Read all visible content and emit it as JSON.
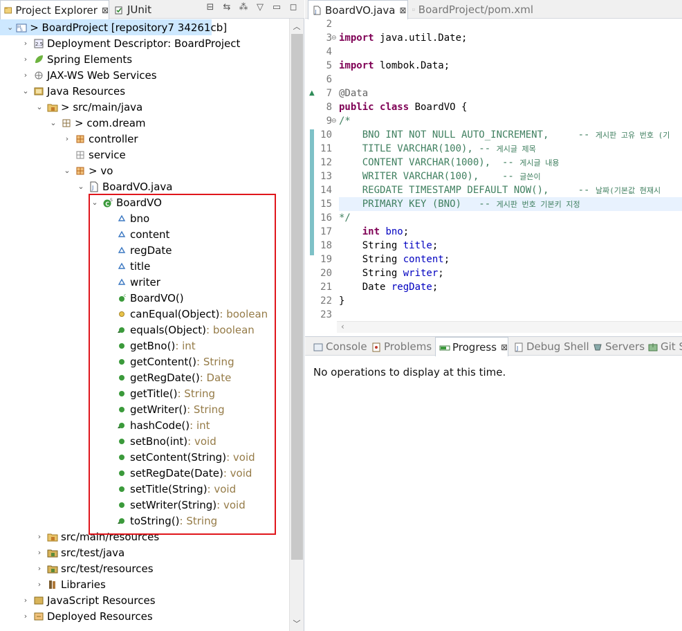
{
  "left_panel": {
    "tabs": [
      {
        "label": "Project Explorer",
        "close": "⊠"
      },
      {
        "label": "JUnit"
      }
    ]
  },
  "tree": [
    {
      "label": "> BoardProject [repository7 34261cb]",
      "indent": 0,
      "twisty": "open",
      "icon": "project"
    },
    {
      "label": "Deployment Descriptor: BoardProject",
      "indent": 1,
      "twisty": "closed",
      "icon": "descriptor"
    },
    {
      "label": "Spring Elements",
      "indent": 1,
      "twisty": "closed",
      "icon": "spring"
    },
    {
      "label": "JAX-WS Web Services",
      "indent": 1,
      "twisty": "closed",
      "icon": "webservice"
    },
    {
      "label": "Java Resources",
      "indent": 1,
      "twisty": "open",
      "icon": "javares"
    },
    {
      "label": "> src/main/java",
      "indent": 2,
      "twisty": "open",
      "icon": "srcfolder"
    },
    {
      "label": "> com.dream",
      "indent": 3,
      "twisty": "open",
      "icon": "package"
    },
    {
      "label": "controller",
      "indent": 4,
      "twisty": "closed",
      "icon": "package-orange"
    },
    {
      "label": "service",
      "indent": 4,
      "twisty": "none",
      "icon": "package-empty"
    },
    {
      "label": "> vo",
      "indent": 4,
      "twisty": "open",
      "icon": "package-orange"
    },
    {
      "label": "BoardVO.java",
      "indent": 5,
      "twisty": "open",
      "icon": "javafile"
    },
    {
      "label": "BoardVO",
      "indent": 6,
      "twisty": "open",
      "icon": "class"
    },
    {
      "label": "bno",
      "indent": 7,
      "twisty": "none",
      "icon": "field"
    },
    {
      "label": "content",
      "indent": 7,
      "twisty": "none",
      "icon": "field"
    },
    {
      "label": "regDate",
      "indent": 7,
      "twisty": "none",
      "icon": "field"
    },
    {
      "label": "title",
      "indent": 7,
      "twisty": "none",
      "icon": "field"
    },
    {
      "label": "writer",
      "indent": 7,
      "twisty": "none",
      "icon": "field"
    },
    {
      "label": "BoardVO()",
      "indent": 7,
      "twisty": "none",
      "icon": "constructor"
    },
    {
      "label": "canEqual(Object)",
      "type": " : boolean",
      "indent": 7,
      "twisty": "none",
      "icon": "method-protected"
    },
    {
      "label": "equals(Object)",
      "type": " : boolean",
      "indent": 7,
      "twisty": "none",
      "icon": "method-override"
    },
    {
      "label": "getBno()",
      "type": " : int",
      "indent": 7,
      "twisty": "none",
      "icon": "method"
    },
    {
      "label": "getContent()",
      "type": " : String",
      "indent": 7,
      "twisty": "none",
      "icon": "method"
    },
    {
      "label": "getRegDate()",
      "type": " : Date",
      "indent": 7,
      "twisty": "none",
      "icon": "method"
    },
    {
      "label": "getTitle()",
      "type": " : String",
      "indent": 7,
      "twisty": "none",
      "icon": "method"
    },
    {
      "label": "getWriter()",
      "type": " : String",
      "indent": 7,
      "twisty": "none",
      "icon": "method"
    },
    {
      "label": "hashCode()",
      "type": " : int",
      "indent": 7,
      "twisty": "none",
      "icon": "method-override"
    },
    {
      "label": "setBno(int)",
      "type": " : void",
      "indent": 7,
      "twisty": "none",
      "icon": "method"
    },
    {
      "label": "setContent(String)",
      "type": " : void",
      "indent": 7,
      "twisty": "none",
      "icon": "method"
    },
    {
      "label": "setRegDate(Date)",
      "type": " : void",
      "indent": 7,
      "twisty": "none",
      "icon": "method"
    },
    {
      "label": "setTitle(String)",
      "type": " : void",
      "indent": 7,
      "twisty": "none",
      "icon": "method"
    },
    {
      "label": "setWriter(String)",
      "type": " : void",
      "indent": 7,
      "twisty": "none",
      "icon": "method"
    },
    {
      "label": "toString()",
      "type": " : String",
      "indent": 7,
      "twisty": "none",
      "icon": "method-override"
    },
    {
      "label": "src/main/resources",
      "indent": 2,
      "twisty": "closed",
      "icon": "srcfolder"
    },
    {
      "label": "src/test/java",
      "indent": 2,
      "twisty": "closed",
      "icon": "testfolder"
    },
    {
      "label": "src/test/resources",
      "indent": 2,
      "twisty": "closed",
      "icon": "testfolder"
    },
    {
      "label": "Libraries",
      "indent": 2,
      "twisty": "closed",
      "icon": "library"
    },
    {
      "label": "JavaScript Resources",
      "indent": 1,
      "twisty": "closed",
      "icon": "jsres"
    },
    {
      "label": "Deployed Resources",
      "indent": 1,
      "twisty": "closed",
      "icon": "deployed"
    }
  ],
  "editor": {
    "tabs": [
      {
        "label": "BoardVO.java",
        "close": "⊠"
      },
      {
        "label": "BoardProject/pom.xml"
      }
    ],
    "lines": [
      {
        "n": "2",
        "parts": []
      },
      {
        "n": "3",
        "fold": "⊖",
        "parts": [
          {
            "t": "import",
            "c": "kw"
          },
          {
            "t": " java.util.Date;"
          }
        ]
      },
      {
        "n": "4",
        "parts": []
      },
      {
        "n": "5",
        "parts": [
          {
            "t": "import",
            "c": "kw"
          },
          {
            "t": " lombok.Data;"
          }
        ]
      },
      {
        "n": "6",
        "parts": []
      },
      {
        "n": "7",
        "marker": "▲",
        "parts": [
          {
            "t": "@Data",
            "c": "ann"
          }
        ]
      },
      {
        "n": "8",
        "parts": [
          {
            "t": "public",
            "c": "kw"
          },
          {
            "t": " "
          },
          {
            "t": "class",
            "c": "kw"
          },
          {
            "t": " BoardVO {"
          }
        ]
      },
      {
        "n": "9",
        "fold": "⊖",
        "parts": [
          {
            "t": "/*",
            "c": "cmt"
          }
        ]
      },
      {
        "n": "10",
        "parts": [
          {
            "t": "    BNO INT NOT NULL AUTO_INCREMENT,     -- ",
            "c": "cmt"
          },
          {
            "t": "게시판 고유 번호 (기",
            "c": "cmt kcm"
          }
        ]
      },
      {
        "n": "11",
        "parts": [
          {
            "t": "    TITLE VARCHAR(100), -- ",
            "c": "cmt"
          },
          {
            "t": "게시글 제목",
            "c": "cmt kcm"
          }
        ]
      },
      {
        "n": "12",
        "parts": [
          {
            "t": "    CONTENT VARCHAR(1000),  -- ",
            "c": "cmt"
          },
          {
            "t": "게시글 내용",
            "c": "cmt kcm"
          }
        ]
      },
      {
        "n": "13",
        "parts": [
          {
            "t": "    WRITER VARCHAR(100),    -- ",
            "c": "cmt"
          },
          {
            "t": "글쓴이",
            "c": "cmt kcm"
          }
        ]
      },
      {
        "n": "14",
        "parts": [
          {
            "t": "    REGDATE TIMESTAMP DEFAULT NOW(),     -- ",
            "c": "cmt"
          },
          {
            "t": "날짜(기본값 현재시",
            "c": "cmt kcm"
          }
        ]
      },
      {
        "n": "15",
        "current": true,
        "parts": [
          {
            "t": "    PRIMARY KEY (BNO)   -- ",
            "c": "cmt"
          },
          {
            "t": "게시판 번호 기본키 지정",
            "c": "cmt kcm"
          }
        ]
      },
      {
        "n": "16",
        "parts": [
          {
            "t": "*/",
            "c": "cmt"
          }
        ]
      },
      {
        "n": "17",
        "parts": [
          {
            "t": "    "
          },
          {
            "t": "int",
            "c": "kw"
          },
          {
            "t": " "
          },
          {
            "t": "bno",
            "c": "fld"
          },
          {
            "t": ";"
          }
        ]
      },
      {
        "n": "18",
        "parts": [
          {
            "t": "    String "
          },
          {
            "t": "title",
            "c": "fld"
          },
          {
            "t": ";"
          }
        ]
      },
      {
        "n": "19",
        "parts": [
          {
            "t": "    String "
          },
          {
            "t": "content",
            "c": "fld"
          },
          {
            "t": ";"
          }
        ]
      },
      {
        "n": "20",
        "parts": [
          {
            "t": "    String "
          },
          {
            "t": "writer",
            "c": "fld"
          },
          {
            "t": ";"
          }
        ]
      },
      {
        "n": "21",
        "parts": [
          {
            "t": "    Date "
          },
          {
            "t": "regDate",
            "c": "fld"
          },
          {
            "t": ";"
          }
        ]
      },
      {
        "n": "22",
        "parts": [
          {
            "t": "}"
          }
        ]
      },
      {
        "n": "23",
        "parts": []
      }
    ]
  },
  "bottom_panel": {
    "tabs": [
      {
        "label": "Console",
        "icon": "console"
      },
      {
        "label": "Problems",
        "icon": "problems"
      },
      {
        "label": "Progress",
        "icon": "progress",
        "active": true,
        "close": "⊠"
      },
      {
        "label": "Debug Shell",
        "icon": "debugshell"
      },
      {
        "label": "Servers",
        "icon": "servers"
      },
      {
        "label": "Git Sta",
        "icon": "git"
      }
    ],
    "message": "No operations to display at this time."
  },
  "colors": {
    "highlight_box": "#e0151b",
    "method_green": "#3b9a3b",
    "field_blue": "#3b78c2",
    "type_label": "#957b47",
    "keyword": "#7f0055",
    "comment": "#3f7f5f",
    "field_ref": "#0000c0"
  }
}
